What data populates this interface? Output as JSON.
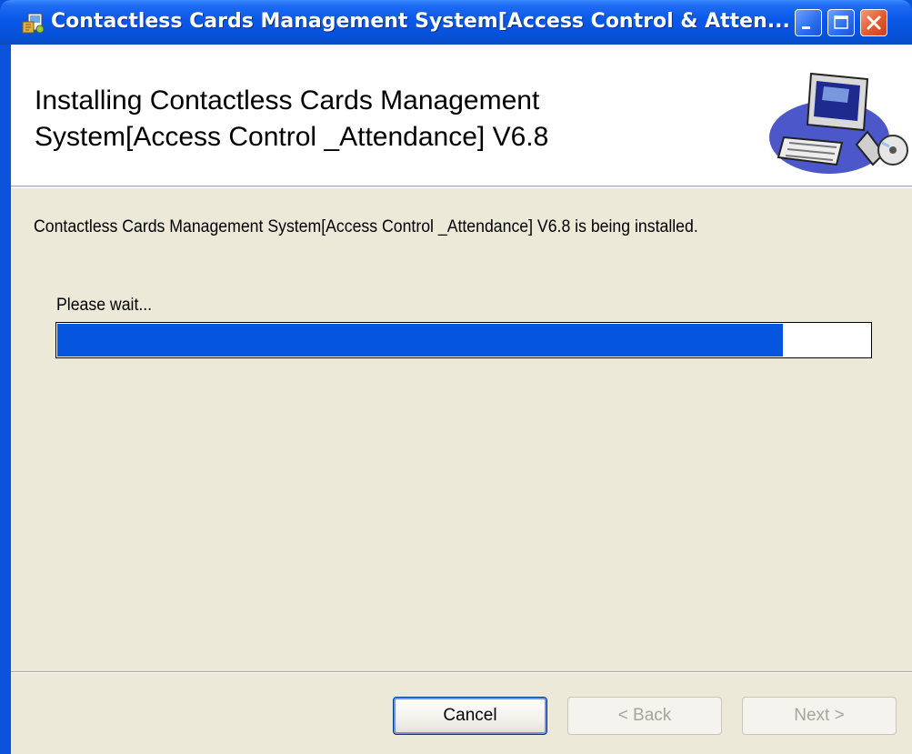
{
  "window": {
    "title": "Contactless Cards Management System[Access Control & Atten...",
    "controls": {
      "minimize": "minimize-icon",
      "maximize": "maximize-icon",
      "close": "close-icon"
    }
  },
  "header": {
    "title": "Installing Contactless Cards Management System[Access Control _Attendance] V6.8",
    "art": "computer-install-icon"
  },
  "body": {
    "description": "Contactless Cards Management System[Access Control _Attendance] V6.8 is being installed.",
    "status_label": "Please wait...",
    "progress_fraction": 0.893
  },
  "buttons": {
    "cancel": "Cancel",
    "back": "< Back",
    "next": "Next >"
  },
  "colors": {
    "titlebar": "#0A58E8",
    "progress": "#0555DE",
    "dialog_bg": "#ECE9D8"
  }
}
